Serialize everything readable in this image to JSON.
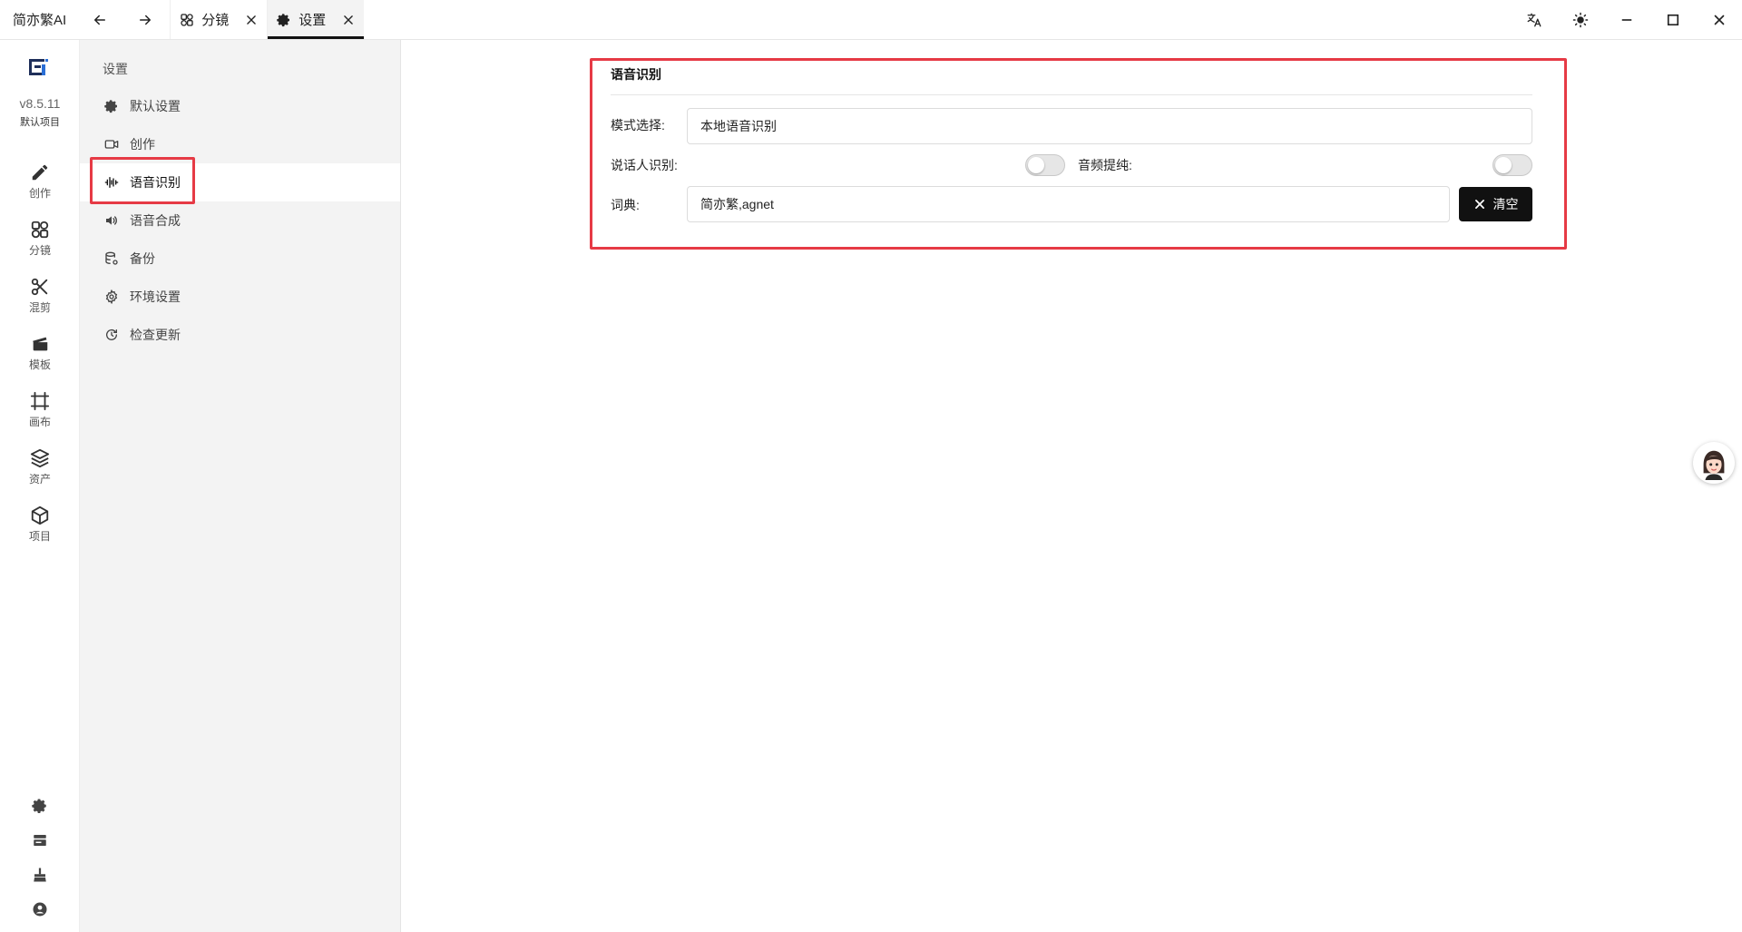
{
  "app": {
    "title": "简亦繁AI",
    "tabs": [
      {
        "label": "分镜",
        "icon": "storyboard-icon"
      },
      {
        "label": "设置",
        "icon": "gear-icon"
      }
    ]
  },
  "rail": {
    "version": "v8.5.11",
    "project": "默认项目",
    "items": [
      {
        "label": "创作",
        "icon": "pencil-icon"
      },
      {
        "label": "分镜",
        "icon": "storyboard-icon"
      },
      {
        "label": "混剪",
        "icon": "scissors-icon"
      },
      {
        "label": "模板",
        "icon": "clapper-icon"
      },
      {
        "label": "画布",
        "icon": "canvas-icon"
      },
      {
        "label": "资产",
        "icon": "layers-icon"
      },
      {
        "label": "项目",
        "icon": "cube-icon"
      }
    ]
  },
  "settings_nav": {
    "title": "设置",
    "items": [
      {
        "label": "默认设置",
        "icon": "gear-icon"
      },
      {
        "label": "创作",
        "icon": "video-icon"
      },
      {
        "label": "语音识别",
        "icon": "waveform-icon"
      },
      {
        "label": "语音合成",
        "icon": "speaker-icon"
      },
      {
        "label": "备份",
        "icon": "database-icon"
      },
      {
        "label": "环境设置",
        "icon": "gear-outline-icon"
      },
      {
        "label": "检查更新",
        "icon": "refresh-icon"
      }
    ],
    "active": "语音识别"
  },
  "panel": {
    "title": "语音识别",
    "mode_label": "模式选择:",
    "mode_value": "本地语音识别",
    "speaker_label": "说话人识别:",
    "speaker_enabled": false,
    "audio_label": "音频提纯:",
    "audio_enabled": false,
    "dict_label": "词典:",
    "dict_value": "简亦繁,agnet",
    "clear_label": "清空"
  },
  "colors": {
    "highlight": "#e63a45",
    "accent": "#111111",
    "sidebar_bg": "#f3f3f3"
  }
}
